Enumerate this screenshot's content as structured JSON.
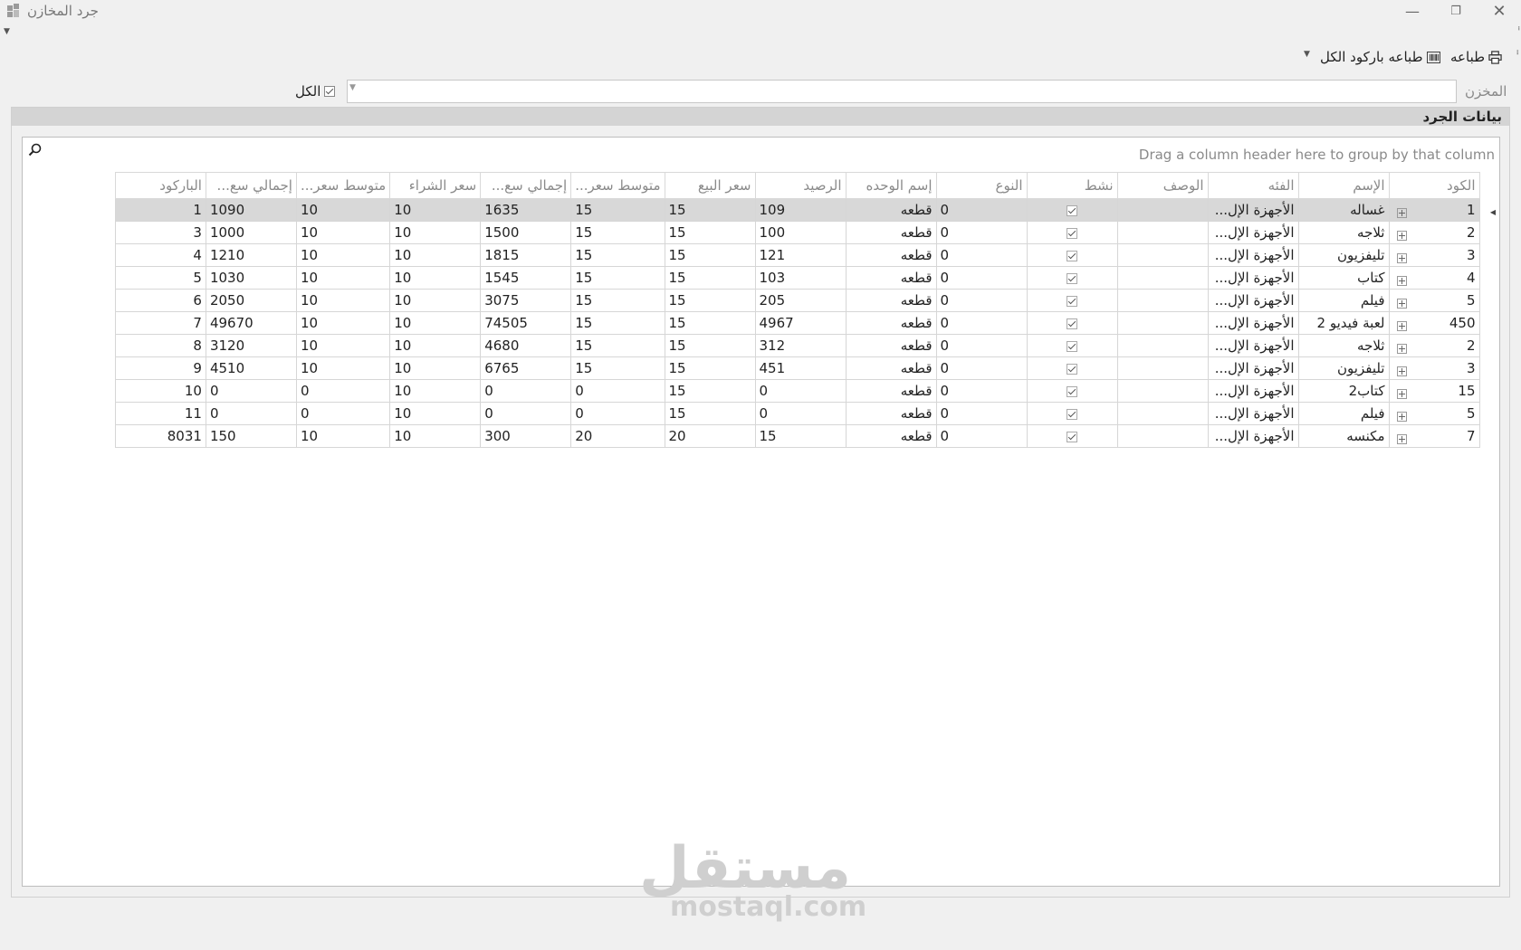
{
  "window": {
    "title": "جرد المخازن"
  },
  "toolbar": {
    "print_label": "طباعه",
    "print_barcode_label": "طباعه باركود الكل"
  },
  "filter": {
    "warehouse_label": "المخزن",
    "warehouse_value": "",
    "all_label": "الكل",
    "all_checked": true
  },
  "panel": {
    "title": "بيانات الجرد"
  },
  "grid": {
    "group_hint": "Drag a column header here to group by that column",
    "columns": [
      "الكود",
      "الإسم",
      "الفئه",
      "الوصف",
      "نشط",
      "النوع",
      "إسم الوحده",
      "الرصيد",
      "سعر البيع",
      "متوسط سعر...",
      "إجمالي سع...",
      "سعر الشراء",
      "متوسط سعر...",
      "إجمالي سع...",
      "الباركود"
    ],
    "rows": [
      {
        "code": "1",
        "name": "غساله",
        "category": "الأجهزة الإل...",
        "desc": "",
        "active": true,
        "type": "0",
        "unit": "قطعه",
        "balance": "109",
        "sell": "15",
        "avg_sell": "15",
        "total_sell": "1635",
        "buy": "10",
        "avg_buy": "10",
        "total_buy": "1090",
        "barcode": "1"
      },
      {
        "code": "2",
        "name": "ثلاجه",
        "category": "الأجهزة الإل...",
        "desc": "",
        "active": true,
        "type": "0",
        "unit": "قطعه",
        "balance": "100",
        "sell": "15",
        "avg_sell": "15",
        "total_sell": "1500",
        "buy": "10",
        "avg_buy": "10",
        "total_buy": "1000",
        "barcode": "3"
      },
      {
        "code": "3",
        "name": "تليفزيون",
        "category": "الأجهزة الإل...",
        "desc": "",
        "active": true,
        "type": "0",
        "unit": "قطعه",
        "balance": "121",
        "sell": "15",
        "avg_sell": "15",
        "total_sell": "1815",
        "buy": "10",
        "avg_buy": "10",
        "total_buy": "1210",
        "barcode": "4"
      },
      {
        "code": "4",
        "name": "كتاب",
        "category": "الأجهزة الإل...",
        "desc": "",
        "active": true,
        "type": "0",
        "unit": "قطعه",
        "balance": "103",
        "sell": "15",
        "avg_sell": "15",
        "total_sell": "1545",
        "buy": "10",
        "avg_buy": "10",
        "total_buy": "1030",
        "barcode": "5"
      },
      {
        "code": "5",
        "name": "فيلم",
        "category": "الأجهزة الإل...",
        "desc": "",
        "active": true,
        "type": "0",
        "unit": "قطعه",
        "balance": "205",
        "sell": "15",
        "avg_sell": "15",
        "total_sell": "3075",
        "buy": "10",
        "avg_buy": "10",
        "total_buy": "2050",
        "barcode": "6"
      },
      {
        "code": "450",
        "name": "لعبة فيديو 2",
        "category": "الأجهزة الإل...",
        "desc": "",
        "active": true,
        "type": "0",
        "unit": "قطعه",
        "balance": "4967",
        "sell": "15",
        "avg_sell": "15",
        "total_sell": "74505",
        "buy": "10",
        "avg_buy": "10",
        "total_buy": "49670",
        "barcode": "7"
      },
      {
        "code": "2",
        "name": "ثلاجه",
        "category": "الأجهزة الإل...",
        "desc": "",
        "active": true,
        "type": "0",
        "unit": "قطعه",
        "balance": "312",
        "sell": "15",
        "avg_sell": "15",
        "total_sell": "4680",
        "buy": "10",
        "avg_buy": "10",
        "total_buy": "3120",
        "barcode": "8"
      },
      {
        "code": "3",
        "name": "تليفزيون",
        "category": "الأجهزة الإل...",
        "desc": "",
        "active": true,
        "type": "0",
        "unit": "قطعه",
        "balance": "451",
        "sell": "15",
        "avg_sell": "15",
        "total_sell": "6765",
        "buy": "10",
        "avg_buy": "10",
        "total_buy": "4510",
        "barcode": "9"
      },
      {
        "code": "15",
        "name": "كتاب2",
        "category": "الأجهزة الإل...",
        "desc": "",
        "active": true,
        "type": "0",
        "unit": "قطعه",
        "balance": "0",
        "sell": "15",
        "avg_sell": "0",
        "total_sell": "0",
        "buy": "10",
        "avg_buy": "0",
        "total_buy": "0",
        "barcode": "10"
      },
      {
        "code": "5",
        "name": "فيلم",
        "category": "الأجهزة الإل...",
        "desc": "",
        "active": true,
        "type": "0",
        "unit": "قطعه",
        "balance": "0",
        "sell": "15",
        "avg_sell": "0",
        "total_sell": "0",
        "buy": "10",
        "avg_buy": "0",
        "total_buy": "0",
        "barcode": "11"
      },
      {
        "code": "7",
        "name": "مكنسه",
        "category": "الأجهزة الإل...",
        "desc": "",
        "active": true,
        "type": "0",
        "unit": "قطعه",
        "balance": "15",
        "sell": "20",
        "avg_sell": "20",
        "total_sell": "300",
        "buy": "10",
        "avg_buy": "10",
        "total_buy": "150",
        "barcode": "8031"
      }
    ],
    "selected_row": 0
  },
  "watermark": {
    "arabic": "مستقل",
    "latin": "mostaql.com"
  },
  "colors": {
    "window_bg": "#f0f0f0",
    "panel_header": "#d4d4d4",
    "selected_row": "#d8d8d8",
    "header_text": "#8a8a8a"
  }
}
